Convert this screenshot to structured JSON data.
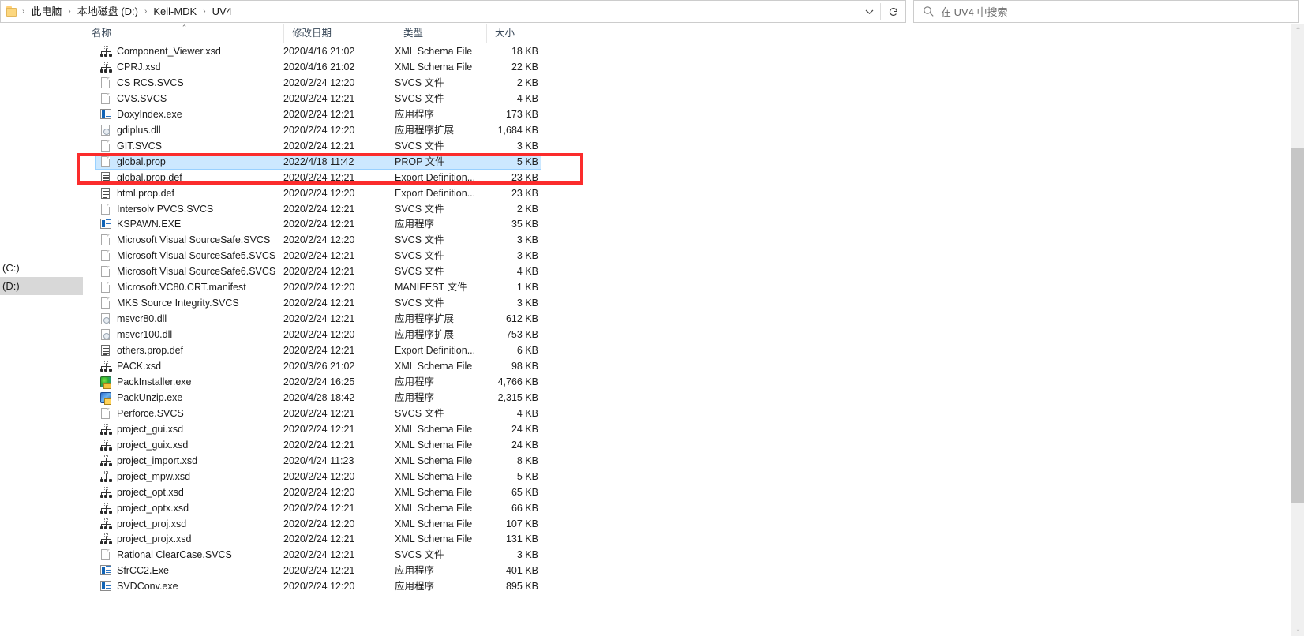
{
  "window": {
    "type": "windows-file-explorer",
    "accent_selection_color": "#cce8ff",
    "annotation_color": "#fb2c2c"
  },
  "address_bar": {
    "folder_icon": "folder-icon",
    "separator": "›",
    "crumbs": [
      "此电脑",
      "本地磁盘 (D:)",
      "Keil-MDK",
      "UV4"
    ],
    "dropdown_icon": "chevron-down-icon",
    "refresh_icon": "refresh-icon"
  },
  "search": {
    "icon": "search-icon",
    "placeholder": "在 UV4 中搜索"
  },
  "nav_pane": {
    "items": [
      {
        "label": "(C:)",
        "selected": false
      },
      {
        "label": "(D:)",
        "selected": true
      }
    ]
  },
  "columns": {
    "name": "名称",
    "date": "修改日期",
    "type": "类型",
    "size": "大小",
    "sort_column": "名称",
    "sort_caret": "⌃"
  },
  "scrollbar": {
    "up_arrow": "⌃",
    "down_arrow": "⌄"
  },
  "files": [
    {
      "name": "Component_Viewer.xsd",
      "date": "2020/4/16 21:02",
      "type": "XML Schema File",
      "size": "18 KB",
      "icon": "xsd-schema-icon",
      "selected": false
    },
    {
      "name": "CPRJ.xsd",
      "date": "2020/4/16 21:02",
      "type": "XML Schema File",
      "size": "22 KB",
      "icon": "xsd-schema-icon",
      "selected": false
    },
    {
      "name": "CS RCS.SVCS",
      "date": "2020/2/24 12:20",
      "type": "SVCS 文件",
      "size": "2 KB",
      "icon": "generic-file-icon",
      "selected": false
    },
    {
      "name": "CVS.SVCS",
      "date": "2020/2/24 12:21",
      "type": "SVCS 文件",
      "size": "4 KB",
      "icon": "generic-file-icon",
      "selected": false
    },
    {
      "name": "DoxyIndex.exe",
      "date": "2020/2/24 12:21",
      "type": "应用程序",
      "size": "173 KB",
      "icon": "application-icon",
      "selected": false
    },
    {
      "name": "gdiplus.dll",
      "date": "2020/2/24 12:20",
      "type": "应用程序扩展",
      "size": "1,684 KB",
      "icon": "dll-icon",
      "selected": false
    },
    {
      "name": "GIT.SVCS",
      "date": "2020/2/24 12:21",
      "type": "SVCS 文件",
      "size": "3 KB",
      "icon": "generic-file-icon",
      "selected": false
    },
    {
      "name": "global.prop",
      "date": "2022/4/18 11:42",
      "type": "PROP 文件",
      "size": "5 KB",
      "icon": "generic-file-icon",
      "selected": true
    },
    {
      "name": "global.prop.def",
      "date": "2020/2/24 12:21",
      "type": "Export Definition...",
      "size": "23 KB",
      "icon": "text-document-icon",
      "selected": false
    },
    {
      "name": "html.prop.def",
      "date": "2020/2/24 12:20",
      "type": "Export Definition...",
      "size": "23 KB",
      "icon": "text-document-icon",
      "selected": false
    },
    {
      "name": "Intersolv PVCS.SVCS",
      "date": "2020/2/24 12:21",
      "type": "SVCS 文件",
      "size": "2 KB",
      "icon": "generic-file-icon",
      "selected": false
    },
    {
      "name": "KSPAWN.EXE",
      "date": "2020/2/24 12:21",
      "type": "应用程序",
      "size": "35 KB",
      "icon": "application-icon",
      "selected": false
    },
    {
      "name": "Microsoft Visual SourceSafe.SVCS",
      "date": "2020/2/24 12:20",
      "type": "SVCS 文件",
      "size": "3 KB",
      "icon": "generic-file-icon",
      "selected": false
    },
    {
      "name": "Microsoft Visual SourceSafe5.SVCS",
      "date": "2020/2/24 12:21",
      "type": "SVCS 文件",
      "size": "3 KB",
      "icon": "generic-file-icon",
      "selected": false
    },
    {
      "name": "Microsoft Visual SourceSafe6.SVCS",
      "date": "2020/2/24 12:21",
      "type": "SVCS 文件",
      "size": "4 KB",
      "icon": "generic-file-icon",
      "selected": false
    },
    {
      "name": "Microsoft.VC80.CRT.manifest",
      "date": "2020/2/24 12:20",
      "type": "MANIFEST 文件",
      "size": "1 KB",
      "icon": "generic-file-icon",
      "selected": false
    },
    {
      "name": "MKS Source Integrity.SVCS",
      "date": "2020/2/24 12:21",
      "type": "SVCS 文件",
      "size": "3 KB",
      "icon": "generic-file-icon",
      "selected": false
    },
    {
      "name": "msvcr80.dll",
      "date": "2020/2/24 12:21",
      "type": "应用程序扩展",
      "size": "612 KB",
      "icon": "dll-icon",
      "selected": false
    },
    {
      "name": "msvcr100.dll",
      "date": "2020/2/24 12:20",
      "type": "应用程序扩展",
      "size": "753 KB",
      "icon": "dll-icon",
      "selected": false
    },
    {
      "name": "others.prop.def",
      "date": "2020/2/24 12:21",
      "type": "Export Definition...",
      "size": "6 KB",
      "icon": "text-document-icon",
      "selected": false
    },
    {
      "name": "PACK.xsd",
      "date": "2020/3/26 21:02",
      "type": "XML Schema File",
      "size": "98 KB",
      "icon": "xsd-schema-icon",
      "selected": false
    },
    {
      "name": "PackInstaller.exe",
      "date": "2020/2/24 16:25",
      "type": "应用程序",
      "size": "4,766 KB",
      "icon": "pack-installer-icon",
      "selected": false
    },
    {
      "name": "PackUnzip.exe",
      "date": "2020/4/28 18:42",
      "type": "应用程序",
      "size": "2,315 KB",
      "icon": "pack-unzip-icon",
      "selected": false
    },
    {
      "name": "Perforce.SVCS",
      "date": "2020/2/24 12:21",
      "type": "SVCS 文件",
      "size": "4 KB",
      "icon": "generic-file-icon",
      "selected": false
    },
    {
      "name": "project_gui.xsd",
      "date": "2020/2/24 12:21",
      "type": "XML Schema File",
      "size": "24 KB",
      "icon": "xsd-schema-icon",
      "selected": false
    },
    {
      "name": "project_guix.xsd",
      "date": "2020/2/24 12:21",
      "type": "XML Schema File",
      "size": "24 KB",
      "icon": "xsd-schema-icon",
      "selected": false
    },
    {
      "name": "project_import.xsd",
      "date": "2020/4/24 11:23",
      "type": "XML Schema File",
      "size": "8 KB",
      "icon": "xsd-schema-icon",
      "selected": false
    },
    {
      "name": "project_mpw.xsd",
      "date": "2020/2/24 12:20",
      "type": "XML Schema File",
      "size": "5 KB",
      "icon": "xsd-schema-icon",
      "selected": false
    },
    {
      "name": "project_opt.xsd",
      "date": "2020/2/24 12:20",
      "type": "XML Schema File",
      "size": "65 KB",
      "icon": "xsd-schema-icon",
      "selected": false
    },
    {
      "name": "project_optx.xsd",
      "date": "2020/2/24 12:21",
      "type": "XML Schema File",
      "size": "66 KB",
      "icon": "xsd-schema-icon",
      "selected": false
    },
    {
      "name": "project_proj.xsd",
      "date": "2020/2/24 12:20",
      "type": "XML Schema File",
      "size": "107 KB",
      "icon": "xsd-schema-icon",
      "selected": false
    },
    {
      "name": "project_projx.xsd",
      "date": "2020/2/24 12:21",
      "type": "XML Schema File",
      "size": "131 KB",
      "icon": "xsd-schema-icon",
      "selected": false
    },
    {
      "name": "Rational ClearCase.SVCS",
      "date": "2020/2/24 12:21",
      "type": "SVCS 文件",
      "size": "3 KB",
      "icon": "generic-file-icon",
      "selected": false
    },
    {
      "name": "SfrCC2.Exe",
      "date": "2020/2/24 12:21",
      "type": "应用程序",
      "size": "401 KB",
      "icon": "application-icon",
      "selected": false
    },
    {
      "name": "SVDConv.exe",
      "date": "2020/2/24 12:20",
      "type": "应用程序",
      "size": "895 KB",
      "icon": "application-icon",
      "selected": false
    }
  ]
}
